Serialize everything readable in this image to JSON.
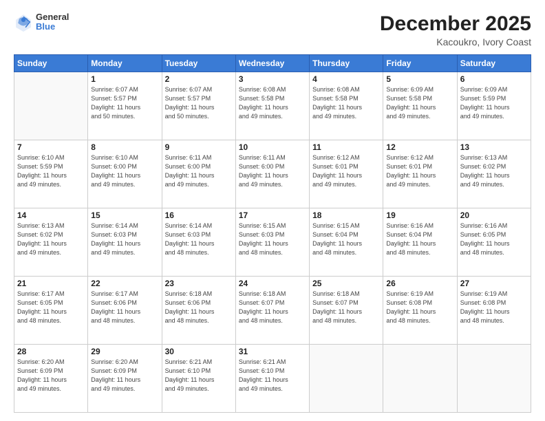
{
  "header": {
    "logo_general": "General",
    "logo_blue": "Blue",
    "month": "December 2025",
    "location": "Kacoukro, Ivory Coast"
  },
  "days_of_week": [
    "Sunday",
    "Monday",
    "Tuesday",
    "Wednesday",
    "Thursday",
    "Friday",
    "Saturday"
  ],
  "weeks": [
    [
      {
        "num": "",
        "info": ""
      },
      {
        "num": "1",
        "info": "Sunrise: 6:07 AM\nSunset: 5:57 PM\nDaylight: 11 hours\nand 50 minutes."
      },
      {
        "num": "2",
        "info": "Sunrise: 6:07 AM\nSunset: 5:57 PM\nDaylight: 11 hours\nand 50 minutes."
      },
      {
        "num": "3",
        "info": "Sunrise: 6:08 AM\nSunset: 5:58 PM\nDaylight: 11 hours\nand 49 minutes."
      },
      {
        "num": "4",
        "info": "Sunrise: 6:08 AM\nSunset: 5:58 PM\nDaylight: 11 hours\nand 49 minutes."
      },
      {
        "num": "5",
        "info": "Sunrise: 6:09 AM\nSunset: 5:58 PM\nDaylight: 11 hours\nand 49 minutes."
      },
      {
        "num": "6",
        "info": "Sunrise: 6:09 AM\nSunset: 5:59 PM\nDaylight: 11 hours\nand 49 minutes."
      }
    ],
    [
      {
        "num": "7",
        "info": "Sunrise: 6:10 AM\nSunset: 5:59 PM\nDaylight: 11 hours\nand 49 minutes."
      },
      {
        "num": "8",
        "info": "Sunrise: 6:10 AM\nSunset: 6:00 PM\nDaylight: 11 hours\nand 49 minutes."
      },
      {
        "num": "9",
        "info": "Sunrise: 6:11 AM\nSunset: 6:00 PM\nDaylight: 11 hours\nand 49 minutes."
      },
      {
        "num": "10",
        "info": "Sunrise: 6:11 AM\nSunset: 6:00 PM\nDaylight: 11 hours\nand 49 minutes."
      },
      {
        "num": "11",
        "info": "Sunrise: 6:12 AM\nSunset: 6:01 PM\nDaylight: 11 hours\nand 49 minutes."
      },
      {
        "num": "12",
        "info": "Sunrise: 6:12 AM\nSunset: 6:01 PM\nDaylight: 11 hours\nand 49 minutes."
      },
      {
        "num": "13",
        "info": "Sunrise: 6:13 AM\nSunset: 6:02 PM\nDaylight: 11 hours\nand 49 minutes."
      }
    ],
    [
      {
        "num": "14",
        "info": "Sunrise: 6:13 AM\nSunset: 6:02 PM\nDaylight: 11 hours\nand 49 minutes."
      },
      {
        "num": "15",
        "info": "Sunrise: 6:14 AM\nSunset: 6:03 PM\nDaylight: 11 hours\nand 49 minutes."
      },
      {
        "num": "16",
        "info": "Sunrise: 6:14 AM\nSunset: 6:03 PM\nDaylight: 11 hours\nand 48 minutes."
      },
      {
        "num": "17",
        "info": "Sunrise: 6:15 AM\nSunset: 6:03 PM\nDaylight: 11 hours\nand 48 minutes."
      },
      {
        "num": "18",
        "info": "Sunrise: 6:15 AM\nSunset: 6:04 PM\nDaylight: 11 hours\nand 48 minutes."
      },
      {
        "num": "19",
        "info": "Sunrise: 6:16 AM\nSunset: 6:04 PM\nDaylight: 11 hours\nand 48 minutes."
      },
      {
        "num": "20",
        "info": "Sunrise: 6:16 AM\nSunset: 6:05 PM\nDaylight: 11 hours\nand 48 minutes."
      }
    ],
    [
      {
        "num": "21",
        "info": "Sunrise: 6:17 AM\nSunset: 6:05 PM\nDaylight: 11 hours\nand 48 minutes."
      },
      {
        "num": "22",
        "info": "Sunrise: 6:17 AM\nSunset: 6:06 PM\nDaylight: 11 hours\nand 48 minutes."
      },
      {
        "num": "23",
        "info": "Sunrise: 6:18 AM\nSunset: 6:06 PM\nDaylight: 11 hours\nand 48 minutes."
      },
      {
        "num": "24",
        "info": "Sunrise: 6:18 AM\nSunset: 6:07 PM\nDaylight: 11 hours\nand 48 minutes."
      },
      {
        "num": "25",
        "info": "Sunrise: 6:18 AM\nSunset: 6:07 PM\nDaylight: 11 hours\nand 48 minutes."
      },
      {
        "num": "26",
        "info": "Sunrise: 6:19 AM\nSunset: 6:08 PM\nDaylight: 11 hours\nand 48 minutes."
      },
      {
        "num": "27",
        "info": "Sunrise: 6:19 AM\nSunset: 6:08 PM\nDaylight: 11 hours\nand 48 minutes."
      }
    ],
    [
      {
        "num": "28",
        "info": "Sunrise: 6:20 AM\nSunset: 6:09 PM\nDaylight: 11 hours\nand 49 minutes."
      },
      {
        "num": "29",
        "info": "Sunrise: 6:20 AM\nSunset: 6:09 PM\nDaylight: 11 hours\nand 49 minutes."
      },
      {
        "num": "30",
        "info": "Sunrise: 6:21 AM\nSunset: 6:10 PM\nDaylight: 11 hours\nand 49 minutes."
      },
      {
        "num": "31",
        "info": "Sunrise: 6:21 AM\nSunset: 6:10 PM\nDaylight: 11 hours\nand 49 minutes."
      },
      {
        "num": "",
        "info": ""
      },
      {
        "num": "",
        "info": ""
      },
      {
        "num": "",
        "info": ""
      }
    ]
  ]
}
